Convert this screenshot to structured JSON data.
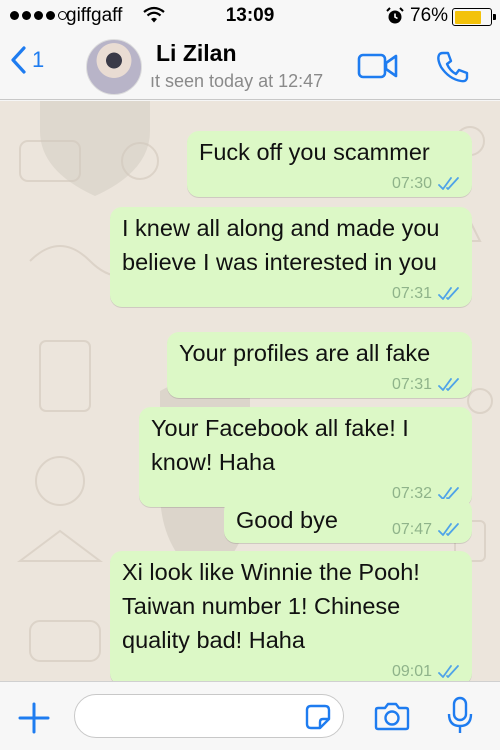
{
  "status_bar": {
    "carrier": "giffgaff",
    "time": "13:09",
    "battery": "76%",
    "battery_level": 0.76
  },
  "header": {
    "back_count": "1",
    "contact_name": "Li Zilan",
    "last_seen": "ıt seen today at 12:47"
  },
  "messages": [
    {
      "text": "Fuck off you scammer",
      "time": "07:30",
      "status": "read"
    },
    {
      "text": "I knew all along and made you believe I was interested in you",
      "time": "07:31",
      "status": "read"
    },
    {
      "text": "Your profiles are all fake",
      "time": "07:31",
      "status": "read"
    },
    {
      "text": "Your Facebook all fake! I know! Haha",
      "time": "07:32",
      "status": "read"
    },
    {
      "text": "Good bye",
      "time": "07:47",
      "status": "read"
    },
    {
      "text": "Xi look like Winnie the Pooh! Taiwan number 1! Chinese quality bad! Haha",
      "time": "09:01",
      "status": "read"
    }
  ],
  "input": {
    "placeholder": ""
  },
  "colors": {
    "accent": "#1e7cf0",
    "outgoing_bubble": "#dcf8c6",
    "read_tick": "#4fa3e8",
    "chat_background": "#ece5dc"
  }
}
